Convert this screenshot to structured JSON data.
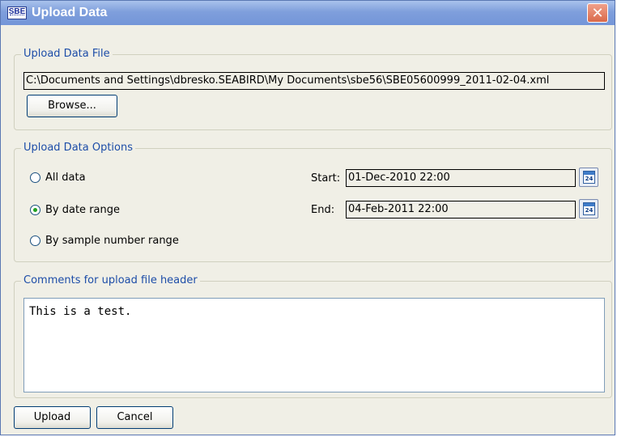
{
  "window": {
    "title": "Upload Data",
    "app_icon_text": "SBE",
    "close_icon": "close-icon",
    "close_symbol": "✕"
  },
  "file_section": {
    "legend": "Upload Data File",
    "path": "C:\\Documents and Settings\\dbresko.SEABIRD\\My Documents\\sbe56\\SBE05600999_2011-02-04.xml",
    "browse_label": "Browse..."
  },
  "options_section": {
    "legend": "Upload Data Options",
    "radios": [
      {
        "label": "All data",
        "checked": false
      },
      {
        "label": "By date range",
        "checked": true
      },
      {
        "label": "By sample number range",
        "checked": false
      }
    ],
    "start_label": "Start:",
    "start_value": "01-Dec-2010 22:00",
    "end_label": "End:",
    "end_value": "04-Feb-2011 22:00",
    "calendar_icon": "calendar-icon",
    "calendar_number": "24"
  },
  "comments_section": {
    "legend": "Comments for upload file header",
    "text": "This is a test."
  },
  "buttons": {
    "upload": "Upload",
    "cancel": "Cancel"
  }
}
